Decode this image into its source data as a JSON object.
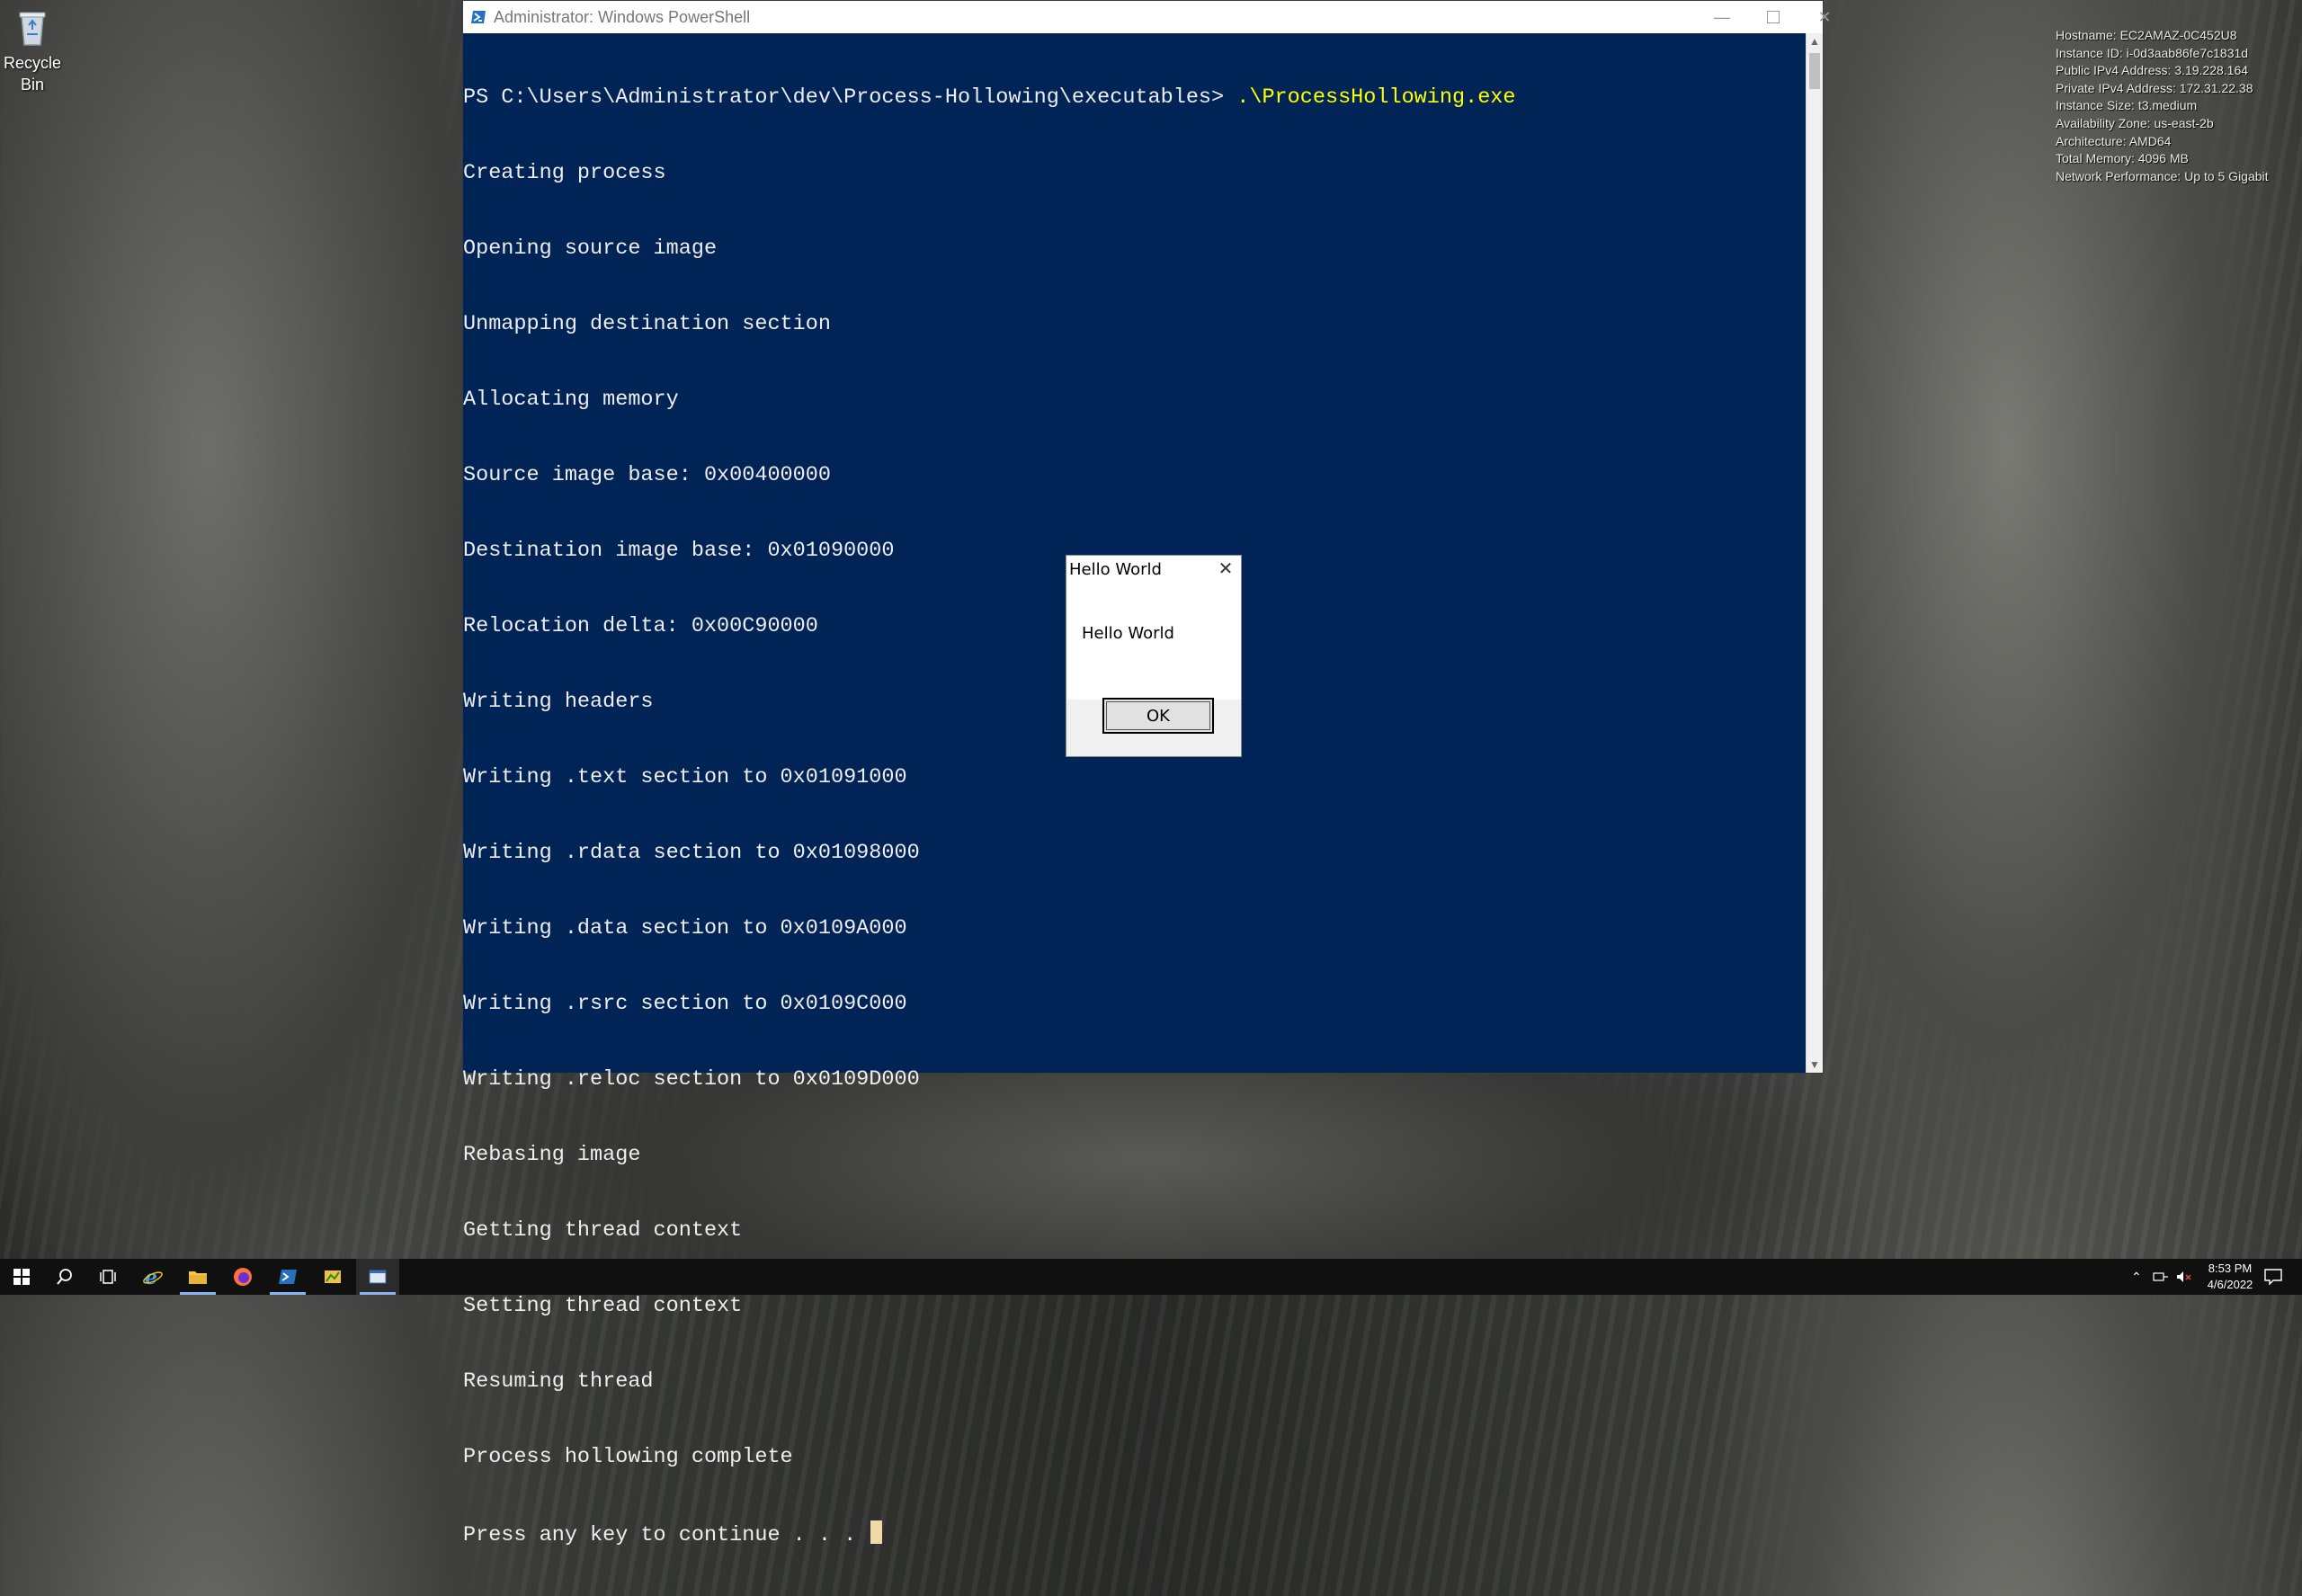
{
  "desktop": {
    "recycle_bin_label": "Recycle Bin"
  },
  "sysinfo": [
    "Hostname: EC2AMAZ-0C452U8",
    "Instance ID: i-0d3aab86fe7c1831d",
    "Public IPv4 Address: 3.19.228.164",
    "Private IPv4 Address: 172.31.22.38",
    "Instance Size: t3.medium",
    "Availability Zone: us-east-2b",
    "Architecture: AMD64",
    "Total Memory: 4096 MB",
    "Network Performance: Up to 5 Gigabit"
  ],
  "powershell": {
    "title": "Administrator: Windows PowerShell",
    "prompt": "PS C:\\Users\\Administrator\\dev\\Process-Hollowing\\executables> ",
    "command": ".\\ProcessHollowing.exe",
    "output": [
      "Creating process",
      "Opening source image",
      "Unmapping destination section",
      "Allocating memory",
      "Source image base: 0x00400000",
      "Destination image base: 0x01090000",
      "Relocation delta: 0x00C90000",
      "Writing headers",
      "Writing .text section to 0x01091000",
      "Writing .rdata section to 0x01098000",
      "Writing .data section to 0x0109A000",
      "Writing .rsrc section to 0x0109C000",
      "Writing .reloc section to 0x0109D000",
      "Rebasing image",
      "Getting thread context",
      "Setting thread context",
      "Resuming thread",
      "Process hollowing complete"
    ],
    "last_line": "Press any key to continue . . . "
  },
  "msgbox": {
    "title": "Hello World",
    "message": "Hello World",
    "ok_label": "OK"
  },
  "taskbar": {
    "clock_time": "8:53 PM",
    "clock_date": "4/6/2022"
  },
  "colors": {
    "console_bg": "#012456",
    "console_fg": "#eeedf0",
    "command_fg": "#ffff00"
  }
}
